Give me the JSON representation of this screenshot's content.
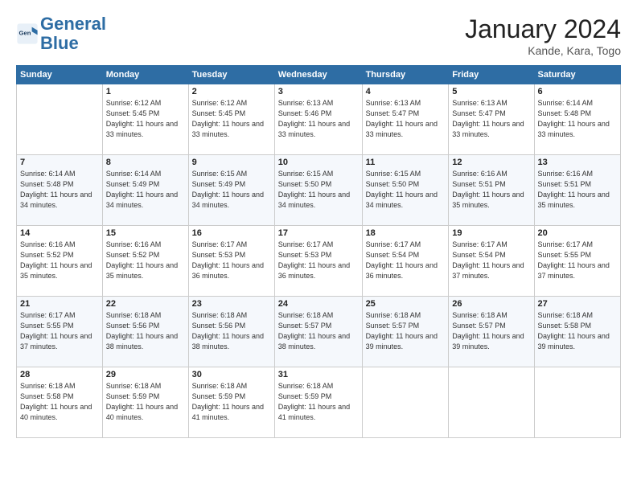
{
  "logo": {
    "line1": "General",
    "line2": "Blue"
  },
  "header": {
    "title": "January 2024",
    "subtitle": "Kande, Kara, Togo"
  },
  "days_of_week": [
    "Sunday",
    "Monday",
    "Tuesday",
    "Wednesday",
    "Thursday",
    "Friday",
    "Saturday"
  ],
  "weeks": [
    [
      {
        "day": "",
        "sunrise": "",
        "sunset": "",
        "daylight": ""
      },
      {
        "day": "1",
        "sunrise": "Sunrise: 6:12 AM",
        "sunset": "Sunset: 5:45 PM",
        "daylight": "Daylight: 11 hours and 33 minutes."
      },
      {
        "day": "2",
        "sunrise": "Sunrise: 6:12 AM",
        "sunset": "Sunset: 5:45 PM",
        "daylight": "Daylight: 11 hours and 33 minutes."
      },
      {
        "day": "3",
        "sunrise": "Sunrise: 6:13 AM",
        "sunset": "Sunset: 5:46 PM",
        "daylight": "Daylight: 11 hours and 33 minutes."
      },
      {
        "day": "4",
        "sunrise": "Sunrise: 6:13 AM",
        "sunset": "Sunset: 5:47 PM",
        "daylight": "Daylight: 11 hours and 33 minutes."
      },
      {
        "day": "5",
        "sunrise": "Sunrise: 6:13 AM",
        "sunset": "Sunset: 5:47 PM",
        "daylight": "Daylight: 11 hours and 33 minutes."
      },
      {
        "day": "6",
        "sunrise": "Sunrise: 6:14 AM",
        "sunset": "Sunset: 5:48 PM",
        "daylight": "Daylight: 11 hours and 33 minutes."
      }
    ],
    [
      {
        "day": "7",
        "sunrise": "Sunrise: 6:14 AM",
        "sunset": "Sunset: 5:48 PM",
        "daylight": "Daylight: 11 hours and 34 minutes."
      },
      {
        "day": "8",
        "sunrise": "Sunrise: 6:14 AM",
        "sunset": "Sunset: 5:49 PM",
        "daylight": "Daylight: 11 hours and 34 minutes."
      },
      {
        "day": "9",
        "sunrise": "Sunrise: 6:15 AM",
        "sunset": "Sunset: 5:49 PM",
        "daylight": "Daylight: 11 hours and 34 minutes."
      },
      {
        "day": "10",
        "sunrise": "Sunrise: 6:15 AM",
        "sunset": "Sunset: 5:50 PM",
        "daylight": "Daylight: 11 hours and 34 minutes."
      },
      {
        "day": "11",
        "sunrise": "Sunrise: 6:15 AM",
        "sunset": "Sunset: 5:50 PM",
        "daylight": "Daylight: 11 hours and 34 minutes."
      },
      {
        "day": "12",
        "sunrise": "Sunrise: 6:16 AM",
        "sunset": "Sunset: 5:51 PM",
        "daylight": "Daylight: 11 hours and 35 minutes."
      },
      {
        "day": "13",
        "sunrise": "Sunrise: 6:16 AM",
        "sunset": "Sunset: 5:51 PM",
        "daylight": "Daylight: 11 hours and 35 minutes."
      }
    ],
    [
      {
        "day": "14",
        "sunrise": "Sunrise: 6:16 AM",
        "sunset": "Sunset: 5:52 PM",
        "daylight": "Daylight: 11 hours and 35 minutes."
      },
      {
        "day": "15",
        "sunrise": "Sunrise: 6:16 AM",
        "sunset": "Sunset: 5:52 PM",
        "daylight": "Daylight: 11 hours and 35 minutes."
      },
      {
        "day": "16",
        "sunrise": "Sunrise: 6:17 AM",
        "sunset": "Sunset: 5:53 PM",
        "daylight": "Daylight: 11 hours and 36 minutes."
      },
      {
        "day": "17",
        "sunrise": "Sunrise: 6:17 AM",
        "sunset": "Sunset: 5:53 PM",
        "daylight": "Daylight: 11 hours and 36 minutes."
      },
      {
        "day": "18",
        "sunrise": "Sunrise: 6:17 AM",
        "sunset": "Sunset: 5:54 PM",
        "daylight": "Daylight: 11 hours and 36 minutes."
      },
      {
        "day": "19",
        "sunrise": "Sunrise: 6:17 AM",
        "sunset": "Sunset: 5:54 PM",
        "daylight": "Daylight: 11 hours and 37 minutes."
      },
      {
        "day": "20",
        "sunrise": "Sunrise: 6:17 AM",
        "sunset": "Sunset: 5:55 PM",
        "daylight": "Daylight: 11 hours and 37 minutes."
      }
    ],
    [
      {
        "day": "21",
        "sunrise": "Sunrise: 6:17 AM",
        "sunset": "Sunset: 5:55 PM",
        "daylight": "Daylight: 11 hours and 37 minutes."
      },
      {
        "day": "22",
        "sunrise": "Sunrise: 6:18 AM",
        "sunset": "Sunset: 5:56 PM",
        "daylight": "Daylight: 11 hours and 38 minutes."
      },
      {
        "day": "23",
        "sunrise": "Sunrise: 6:18 AM",
        "sunset": "Sunset: 5:56 PM",
        "daylight": "Daylight: 11 hours and 38 minutes."
      },
      {
        "day": "24",
        "sunrise": "Sunrise: 6:18 AM",
        "sunset": "Sunset: 5:57 PM",
        "daylight": "Daylight: 11 hours and 38 minutes."
      },
      {
        "day": "25",
        "sunrise": "Sunrise: 6:18 AM",
        "sunset": "Sunset: 5:57 PM",
        "daylight": "Daylight: 11 hours and 39 minutes."
      },
      {
        "day": "26",
        "sunrise": "Sunrise: 6:18 AM",
        "sunset": "Sunset: 5:57 PM",
        "daylight": "Daylight: 11 hours and 39 minutes."
      },
      {
        "day": "27",
        "sunrise": "Sunrise: 6:18 AM",
        "sunset": "Sunset: 5:58 PM",
        "daylight": "Daylight: 11 hours and 39 minutes."
      }
    ],
    [
      {
        "day": "28",
        "sunrise": "Sunrise: 6:18 AM",
        "sunset": "Sunset: 5:58 PM",
        "daylight": "Daylight: 11 hours and 40 minutes."
      },
      {
        "day": "29",
        "sunrise": "Sunrise: 6:18 AM",
        "sunset": "Sunset: 5:59 PM",
        "daylight": "Daylight: 11 hours and 40 minutes."
      },
      {
        "day": "30",
        "sunrise": "Sunrise: 6:18 AM",
        "sunset": "Sunset: 5:59 PM",
        "daylight": "Daylight: 11 hours and 41 minutes."
      },
      {
        "day": "31",
        "sunrise": "Sunrise: 6:18 AM",
        "sunset": "Sunset: 5:59 PM",
        "daylight": "Daylight: 11 hours and 41 minutes."
      },
      {
        "day": "",
        "sunrise": "",
        "sunset": "",
        "daylight": ""
      },
      {
        "day": "",
        "sunrise": "",
        "sunset": "",
        "daylight": ""
      },
      {
        "day": "",
        "sunrise": "",
        "sunset": "",
        "daylight": ""
      }
    ]
  ]
}
